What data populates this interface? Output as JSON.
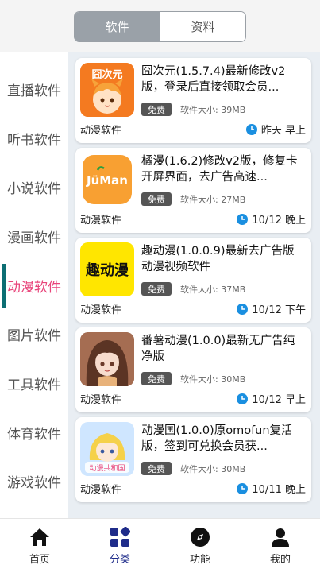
{
  "segment": {
    "tabs": [
      "软件",
      "资料"
    ],
    "active": "软件"
  },
  "sidebar": {
    "items": [
      "直播软件",
      "听书软件",
      "小说软件",
      "漫画软件",
      "动漫软件",
      "图片软件",
      "工具软件",
      "体育软件",
      "游戏软件"
    ],
    "active": "动漫软件"
  },
  "cards": [
    {
      "title": "囧次元(1.5.7.4)最新修改v2版，登录后直接领取会员...",
      "badge": "免费",
      "size": "软件大小: 39MB",
      "category": "动漫软件",
      "time": "昨天 早上",
      "icon": "jiongciyuan-app-icon",
      "icon_text": "囧次元"
    },
    {
      "title": "橘漫(1.6.2)修改v2版，修复卡开屏界面，去广告高速...",
      "badge": "免费",
      "size": "软件大小: 27MB",
      "category": "动漫软件",
      "time": "10/12 晚上",
      "icon": "juman-app-icon",
      "icon_text": "JüMan"
    },
    {
      "title": "趣动漫(1.0.0.9)最新去广告版动漫视频软件",
      "badge": "免费",
      "size": "软件大小: 37MB",
      "category": "动漫软件",
      "time": "10/12 下午",
      "icon": "qudongman-app-icon",
      "icon_text": "趣动漫"
    },
    {
      "title": "番薯动漫(1.0.0)最新无广告纯净版",
      "badge": "免费",
      "size": "软件大小: 30MB",
      "category": "动漫软件",
      "time": "10/12 早上",
      "icon": "fanshu-app-icon",
      "icon_text": ""
    },
    {
      "title": "动漫国(1.0.0)原omofun复活版，签到可兑换会员获...",
      "badge": "免费",
      "size": "软件大小: 30MB",
      "category": "动漫软件",
      "time": "10/11 晚上",
      "icon": "dongmanguo-app-icon",
      "icon_text": "动漫共和国"
    }
  ],
  "bottom_nav": [
    {
      "label": "首页",
      "icon": "home-icon"
    },
    {
      "label": "分类",
      "icon": "category-icon",
      "active": true
    },
    {
      "label": "功能",
      "icon": "compass-icon"
    },
    {
      "label": "我的",
      "icon": "user-icon"
    }
  ],
  "colors": {
    "accent_pink": "#e8447a",
    "nav_active": "#1f2c8a",
    "clock_blue": "#1a8fe0"
  }
}
